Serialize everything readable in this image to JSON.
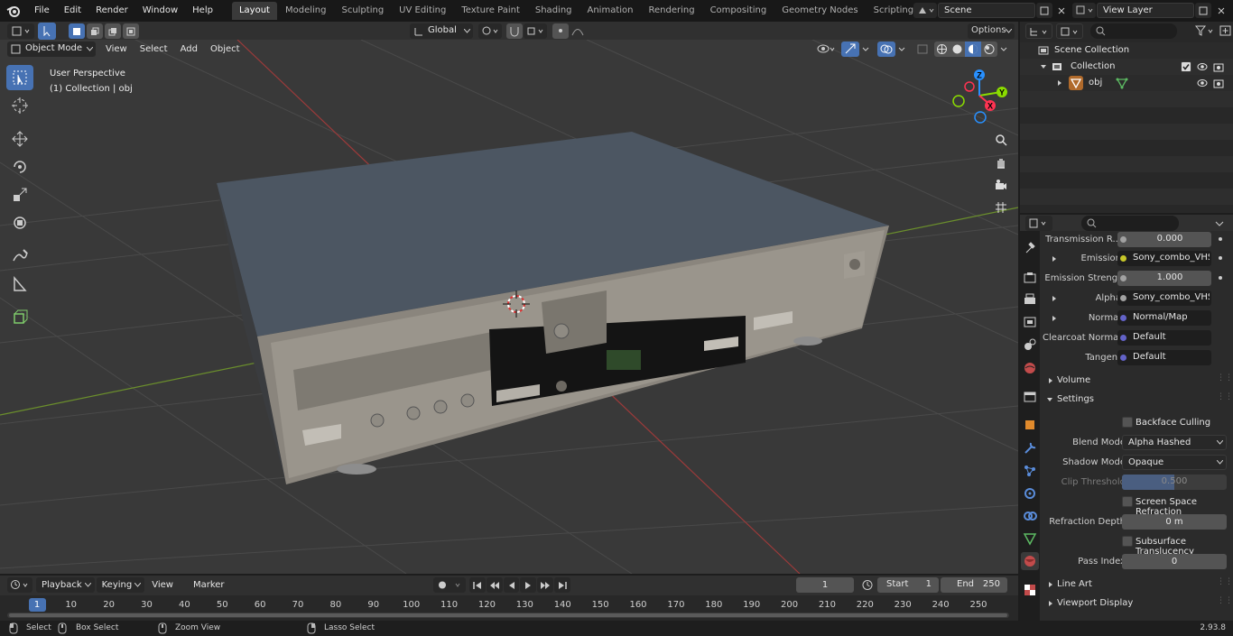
{
  "topbar": {
    "menus": [
      "File",
      "Edit",
      "Render",
      "Window",
      "Help"
    ],
    "workspaces": [
      "Layout",
      "Modeling",
      "Sculpting",
      "UV Editing",
      "Texture Paint",
      "Shading",
      "Animation",
      "Rendering",
      "Compositing",
      "Geometry Nodes",
      "Scripting"
    ],
    "active_workspace": "Layout",
    "scene": "Scene",
    "view_layer": "View Layer"
  },
  "viewport": {
    "mode": "Object Mode",
    "menus": [
      "View",
      "Select",
      "Add",
      "Object"
    ],
    "transform_orientation": "Global",
    "options_label": "Options",
    "overlay_title": "User Perspective",
    "overlay_subtitle": "(1) Collection | obj",
    "gizmo_axes": {
      "x": "X",
      "y": "Y",
      "z": "Z"
    }
  },
  "outliner": {
    "scene_collection": "Scene Collection",
    "collection": "Collection",
    "object": "obj"
  },
  "properties": {
    "rows": [
      {
        "label": "Transmission R...",
        "value": "0.000",
        "socket": "#a1a1a1",
        "style": "num"
      },
      {
        "label": "Emission",
        "value": "Sony_combo_VHS_p...",
        "socket": "#c7c729",
        "style": "link",
        "expand": true
      },
      {
        "label": "Emission Strengt",
        "value": "1.000",
        "socket": "#a1a1a1",
        "style": "num"
      },
      {
        "label": "Alpha",
        "value": "Sony_combo_VHS_p...",
        "socket": "#a1a1a1",
        "style": "link",
        "expand": true
      },
      {
        "label": "Normal",
        "value": "Normal/Map",
        "socket": "#6363c7",
        "style": "link",
        "expand": true
      },
      {
        "label": "Clearcoat Normal",
        "value": "Default",
        "socket": "#6363c7",
        "style": "link"
      },
      {
        "label": "Tangent",
        "value": "Default",
        "socket": "#6363c7",
        "style": "link"
      }
    ],
    "volume": "Volume",
    "settings": "Settings",
    "backface_culling": "Backface Culling",
    "blend_mode_label": "Blend Mode",
    "blend_mode": "Alpha Hashed",
    "shadow_mode_label": "Shadow Mode",
    "shadow_mode": "Opaque",
    "clip_threshold_label": "Clip Threshold",
    "clip_threshold": "0.500",
    "ssr": "Screen Space Refraction",
    "refraction_depth_label": "Refraction Depth",
    "refraction_depth": "0 m",
    "subsurface": "Subsurface Translucency",
    "pass_index_label": "Pass Index",
    "pass_index": "0",
    "line_art": "Line Art",
    "viewport_display": "Viewport Display"
  },
  "timeline": {
    "menus": [
      "Playback",
      "Keying",
      "View",
      "Marker"
    ],
    "current_frame": "1",
    "start_label": "Start",
    "start": "1",
    "end_label": "End",
    "end": "250",
    "ticks": [
      "1",
      "10",
      "20",
      "30",
      "40",
      "50",
      "60",
      "70",
      "80",
      "90",
      "100",
      "110",
      "120",
      "130",
      "140",
      "150",
      "160",
      "170",
      "180",
      "190",
      "200",
      "210",
      "220",
      "230",
      "240",
      "250"
    ]
  },
  "statusbar": {
    "select": "Select",
    "box_select": "Box Select",
    "zoom_view": "Zoom View",
    "lasso_select": "Lasso Select",
    "version": "2.93.8"
  },
  "colors": {
    "accent": "#4772b3",
    "x_axis": "#ff3352",
    "y_axis": "#8bdc00",
    "z_axis": "#2890ff"
  }
}
